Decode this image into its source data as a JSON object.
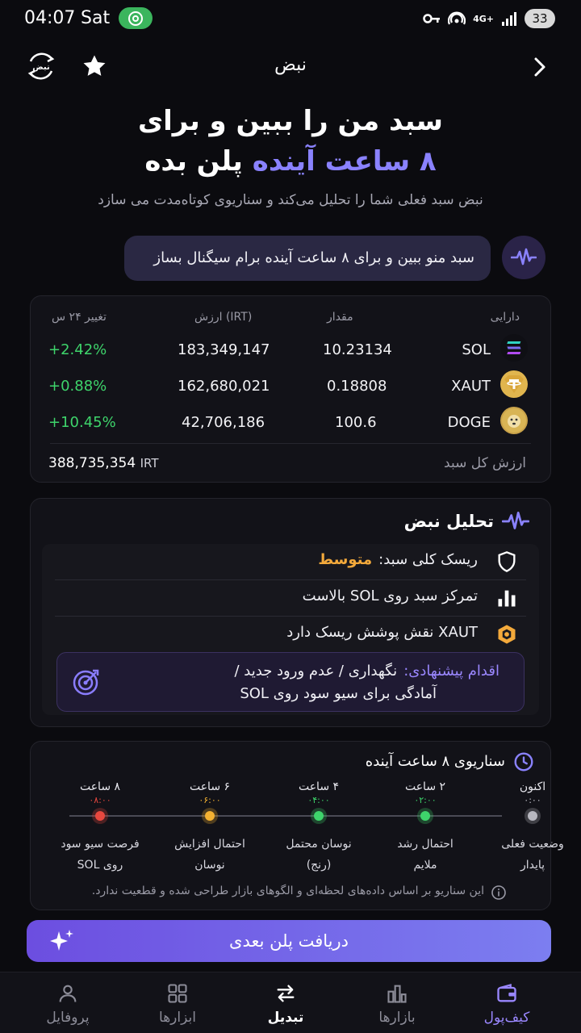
{
  "status": {
    "time": "04:07",
    "day": "Sat",
    "network": "4G+",
    "battery": "33"
  },
  "header": {
    "title": "نبض",
    "logo_text": "نبض"
  },
  "hero": {
    "line1": "سبد من را ببین و برای",
    "line2_accent": "۸ ساعت آینده",
    "line2_rest": "پلن بده",
    "subtitle": "نبض سبد فعلی شما را تحلیل می‌کند و سناریوی کوتاه‌مدت می سازد"
  },
  "prompt": {
    "text": "سبد منو ببین و برای ۸ ساعت آینده برام سیگنال بساز"
  },
  "portfolio": {
    "headers": {
      "asset": "دارایی",
      "amount": "مقدار",
      "value": "ارزش (IRT)",
      "change": "تغییر ۲۴ س"
    },
    "rows": [
      {
        "symbol": "SOL",
        "amount": "10.23134",
        "value": "183,349,147",
        "change": "+2.42%"
      },
      {
        "symbol": "XAUT",
        "amount": "0.18808",
        "value": "162,680,021",
        "change": "+0.88%"
      },
      {
        "symbol": "DOGE",
        "amount": "100.6",
        "value": "42,706,186",
        "change": "+10.45%"
      }
    ],
    "total_label": "ارزش کل سبد",
    "total_value": "388,735,354",
    "total_unit": "IRT"
  },
  "analysis": {
    "title": "تحلیل نبض",
    "risk_label": "ریسک کلی سبد:",
    "risk_value": "متوسط",
    "concentration": "تمرکز سبد روی SOL بالاست",
    "hedge": "XAUT نقش پوشش ریسک دارد",
    "reco_label": "اقدام پیشنهادی:",
    "reco_line1": "نگهداری / عدم ورود جدید /",
    "reco_line2": "آمادگی برای سیو سود روی SOL"
  },
  "scenario": {
    "title": "سناریوی ۸ ساعت آینده",
    "steps": [
      {
        "head": "اکنون",
        "time": "۰:۰۰",
        "label1": "وضعیت فعلی",
        "label2": "پایدار",
        "color": "#b8b8c0",
        "time_color": "#c8c8d0"
      },
      {
        "head": "۲ ساعت",
        "time": "۰۲:۰۰",
        "label1": "احتمال رشد",
        "label2": "ملایم",
        "color": "#3ed46b",
        "time_color": "#3ed46b"
      },
      {
        "head": "۴ ساعت",
        "time": "۰۴:۰۰",
        "label1": "نوسان محتمل",
        "label2": "(رنج)",
        "color": "#3ed46b",
        "time_color": "#3ed46b"
      },
      {
        "head": "۶ ساعت",
        "time": "۰۶:۰۰",
        "label1": "احتمال افزایش",
        "label2": "نوسان",
        "color": "#f3b132",
        "time_color": "#f3b132"
      },
      {
        "head": "۸ ساعت",
        "time": "۰۸:۰۰",
        "label1": "فرصت سیو سود",
        "label2": "روی SOL",
        "color": "#e8483f",
        "time_color": "#e8483f"
      }
    ],
    "note": "این سناریو بر اساس داده‌های لحظه‌ای و الگوهای بازار طراحی شده و قطعیت ندارد."
  },
  "cta": {
    "label": "دریافت پلن بعدی"
  },
  "nav": {
    "wallet": "کیف‌پول",
    "markets": "بازارها",
    "swap": "تبدیل",
    "tools": "ابزارها",
    "profile": "پروفایل"
  },
  "colors": {
    "accent": "#8a82ff",
    "positive": "#3ed46b",
    "warning": "#f3a93b",
    "danger": "#e8483f",
    "background": "#0b0b0f"
  },
  "icons": [
    "back-chevron-icon",
    "star-icon",
    "pulse-icon",
    "shield-icon",
    "bar-chart-icon",
    "hexagon-icon",
    "target-icon",
    "clock-icon",
    "info-icon",
    "sparkle-icon",
    "wallet-icon",
    "market-icon",
    "swap-icon",
    "grid-icon",
    "user-icon"
  ]
}
